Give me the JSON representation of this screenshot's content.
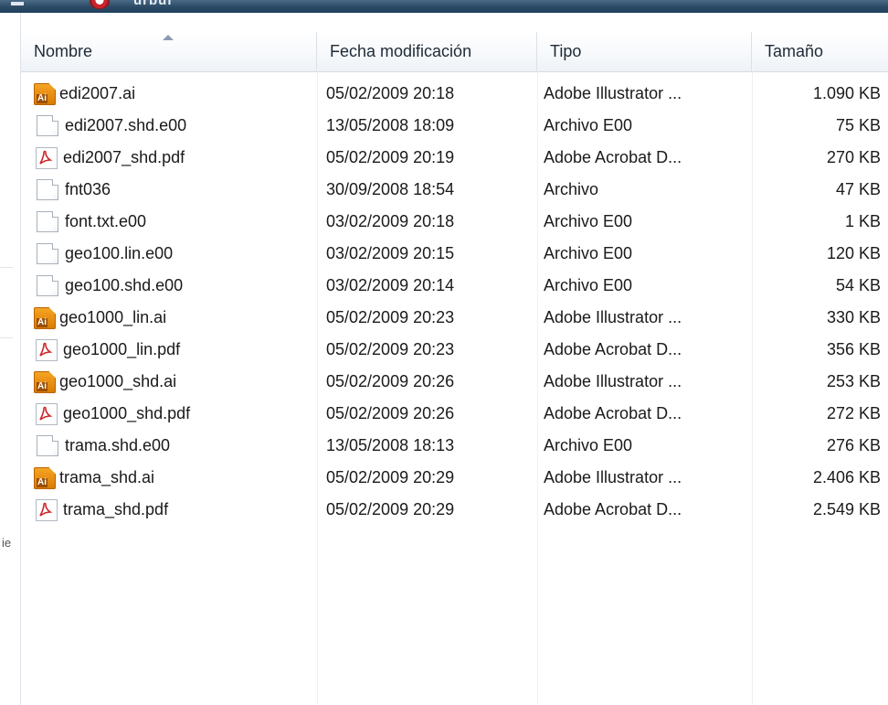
{
  "window": {
    "title": "urbur"
  },
  "columns": {
    "name": "Nombre",
    "date": "Fecha modificación",
    "type": "Tipo",
    "size": "Tamaño"
  },
  "files": [
    {
      "name": "edi2007.ai",
      "date": "05/02/2009 20:18",
      "type": "Adobe Illustrator ...",
      "size": "1.090 KB",
      "icon": "illustrator-file-icon"
    },
    {
      "name": "edi2007.shd.e00",
      "date": "13/05/2008 18:09",
      "type": "Archivo E00",
      "size": "75 KB",
      "icon": "generic-file-icon"
    },
    {
      "name": "edi2007_shd.pdf",
      "date": "05/02/2009 20:19",
      "type": "Adobe Acrobat D...",
      "size": "270 KB",
      "icon": "pdf-file-icon"
    },
    {
      "name": "fnt036",
      "date": "30/09/2008 18:54",
      "type": "Archivo",
      "size": "47 KB",
      "icon": "generic-file-icon"
    },
    {
      "name": "font.txt.e00",
      "date": "03/02/2009 20:18",
      "type": "Archivo E00",
      "size": "1 KB",
      "icon": "generic-file-icon"
    },
    {
      "name": "geo100.lin.e00",
      "date": "03/02/2009 20:15",
      "type": "Archivo E00",
      "size": "120 KB",
      "icon": "generic-file-icon"
    },
    {
      "name": "geo100.shd.e00",
      "date": "03/02/2009 20:14",
      "type": "Archivo E00",
      "size": "54 KB",
      "icon": "generic-file-icon"
    },
    {
      "name": "geo1000_lin.ai",
      "date": "05/02/2009 20:23",
      "type": "Adobe Illustrator ...",
      "size": "330 KB",
      "icon": "illustrator-file-icon"
    },
    {
      "name": "geo1000_lin.pdf",
      "date": "05/02/2009 20:23",
      "type": "Adobe Acrobat D...",
      "size": "356 KB",
      "icon": "pdf-file-icon"
    },
    {
      "name": "geo1000_shd.ai",
      "date": "05/02/2009 20:26",
      "type": "Adobe Illustrator ...",
      "size": "253 KB",
      "icon": "illustrator-file-icon"
    },
    {
      "name": "geo1000_shd.pdf",
      "date": "05/02/2009 20:26",
      "type": "Adobe Acrobat D...",
      "size": "272 KB",
      "icon": "pdf-file-icon"
    },
    {
      "name": "trama.shd.e00",
      "date": "13/05/2008 18:13",
      "type": "Archivo E00",
      "size": "276 KB",
      "icon": "generic-file-icon"
    },
    {
      "name": "trama_shd.ai",
      "date": "05/02/2009 20:29",
      "type": "Adobe Illustrator ...",
      "size": "2.406 KB",
      "icon": "illustrator-file-icon"
    },
    {
      "name": "trama_shd.pdf",
      "date": "05/02/2009 20:29",
      "type": "Adobe Acrobat D...",
      "size": "2.549 KB",
      "icon": "pdf-file-icon"
    }
  ],
  "navpane": {
    "fragment": "ie"
  }
}
